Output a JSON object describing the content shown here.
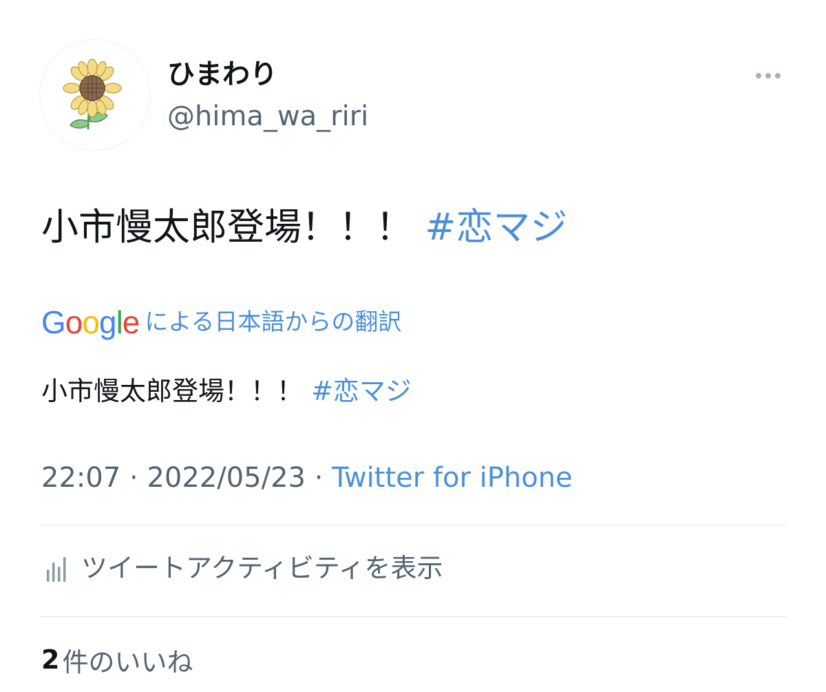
{
  "author": {
    "display_name": "ひまわり",
    "username": "@hima_wa_riri",
    "avatar_icon": "sunflower-avatar"
  },
  "tweet": {
    "text": "小市慢太郎登場！！！ ",
    "hashtag": "#恋マジ"
  },
  "translation": {
    "provider_logo": "Google",
    "label": "による日本語からの翻訳",
    "text": "小市慢太郎登場！！！ ",
    "hashtag": "#恋マジ"
  },
  "meta": {
    "time": "22:07",
    "date": "2022/05/23",
    "separator": " · ",
    "source": "Twitter for iPhone"
  },
  "activity": {
    "label": "ツイートアクティビティを表示",
    "icon": "bar-chart-icon"
  },
  "likes": {
    "count": "2",
    "label": "件のいいね"
  },
  "colors": {
    "link": "#4a90d9",
    "text_primary": "#0f1419",
    "text_secondary": "#536471",
    "divider": "#e1e5e8"
  }
}
